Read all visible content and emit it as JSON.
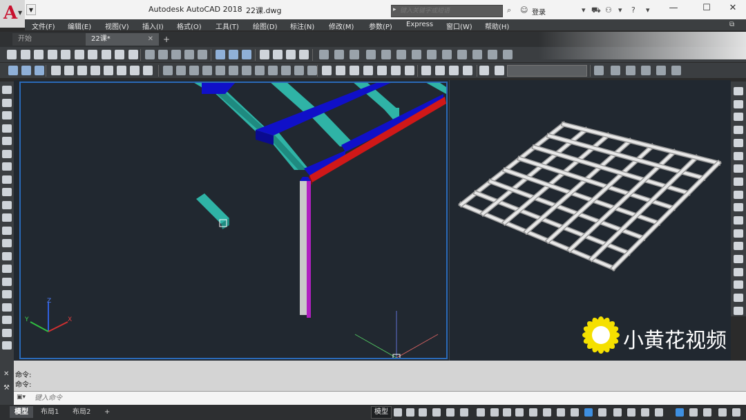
{
  "app": {
    "title": "Autodesk AutoCAD 2018",
    "file": "22课.dwg",
    "search_placeholder": "键入关键字或短语",
    "login": "登录"
  },
  "menu": [
    "文件(F)",
    "编辑(E)",
    "视图(V)",
    "插入(I)",
    "格式(O)",
    "工具(T)",
    "绘图(D)",
    "标注(N)",
    "修改(M)",
    "参数(P)",
    "Express",
    "窗口(W)",
    "帮助(H)"
  ],
  "tabs": {
    "start": "开始",
    "active": "22课*"
  },
  "commands": {
    "line1": "命令:",
    "line2": "命令:",
    "input_placeholder": "键入命令"
  },
  "status": {
    "model_tab": "模型",
    "layout1": "布局1",
    "layout2": "布局2",
    "add": "+",
    "model_label": "模型"
  },
  "watermark": {
    "text": "小黄花视频"
  },
  "ucs": {
    "z": "Z",
    "y": "Y",
    "x": "X"
  },
  "colors": {
    "beam_cyan": "#2fb3a6",
    "beam_blue": "#1010c8",
    "beam_red": "#d01818",
    "column_magenta": "#b020c0",
    "viewport_border": "#2a6ab8",
    "mesh_white": "#e8e8e8"
  }
}
